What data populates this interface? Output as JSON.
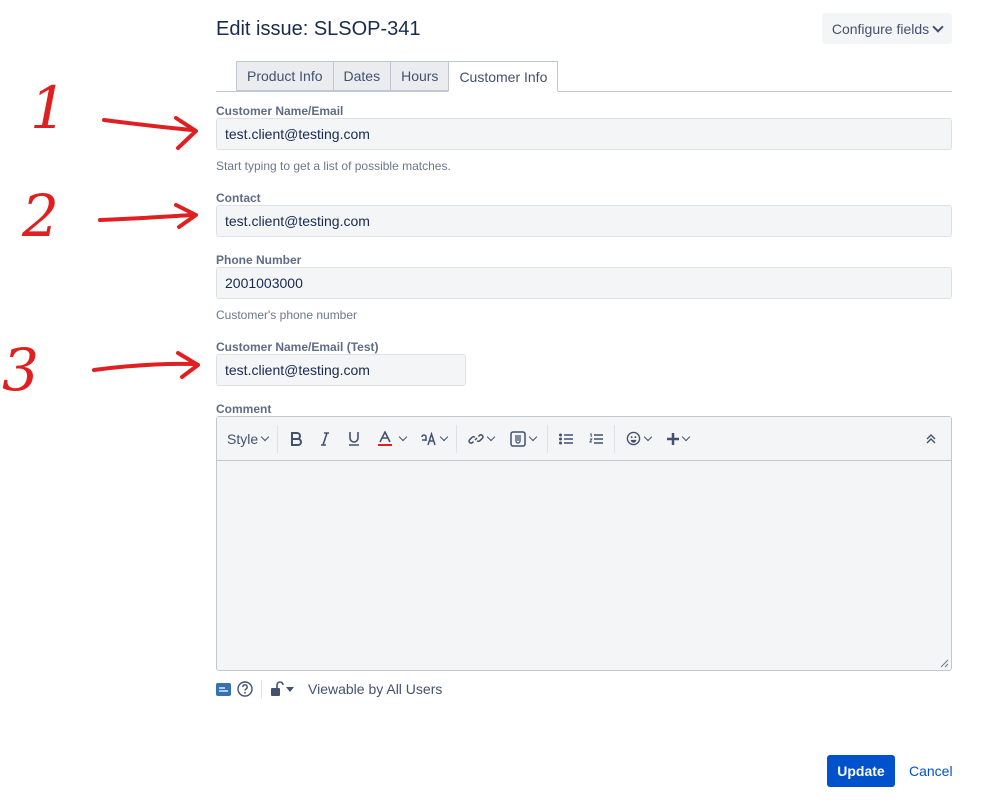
{
  "header": {
    "title": "Edit issue: SLSOP-341",
    "configure_label": "Configure fields"
  },
  "tabs": [
    {
      "label": "Product Info"
    },
    {
      "label": "Dates"
    },
    {
      "label": "Hours"
    },
    {
      "label": "Customer Info",
      "active": true
    }
  ],
  "fields": {
    "customer_name": {
      "label": "Customer Name/Email",
      "value": "test.client@testing.com",
      "help": "Start typing to get a list of possible matches."
    },
    "contact": {
      "label": "Contact",
      "value": "test.client@testing.com"
    },
    "phone": {
      "label": "Phone Number",
      "value": "2001003000",
      "help": "Customer's phone number"
    },
    "customer_name_test": {
      "label": "Customer Name/Email (Test)",
      "value": "test.client@testing.com"
    }
  },
  "comment": {
    "label": "Comment",
    "toolbar": {
      "style_label": "Style"
    },
    "visibility": "Viewable by All Users"
  },
  "actions": {
    "update_label": "Update",
    "cancel_label": "Cancel"
  },
  "annotations": [
    "1",
    "2",
    "3"
  ],
  "colors": {
    "accent": "#0052cc",
    "annotation": "#e02020",
    "field_bg": "#f4f5f7"
  }
}
